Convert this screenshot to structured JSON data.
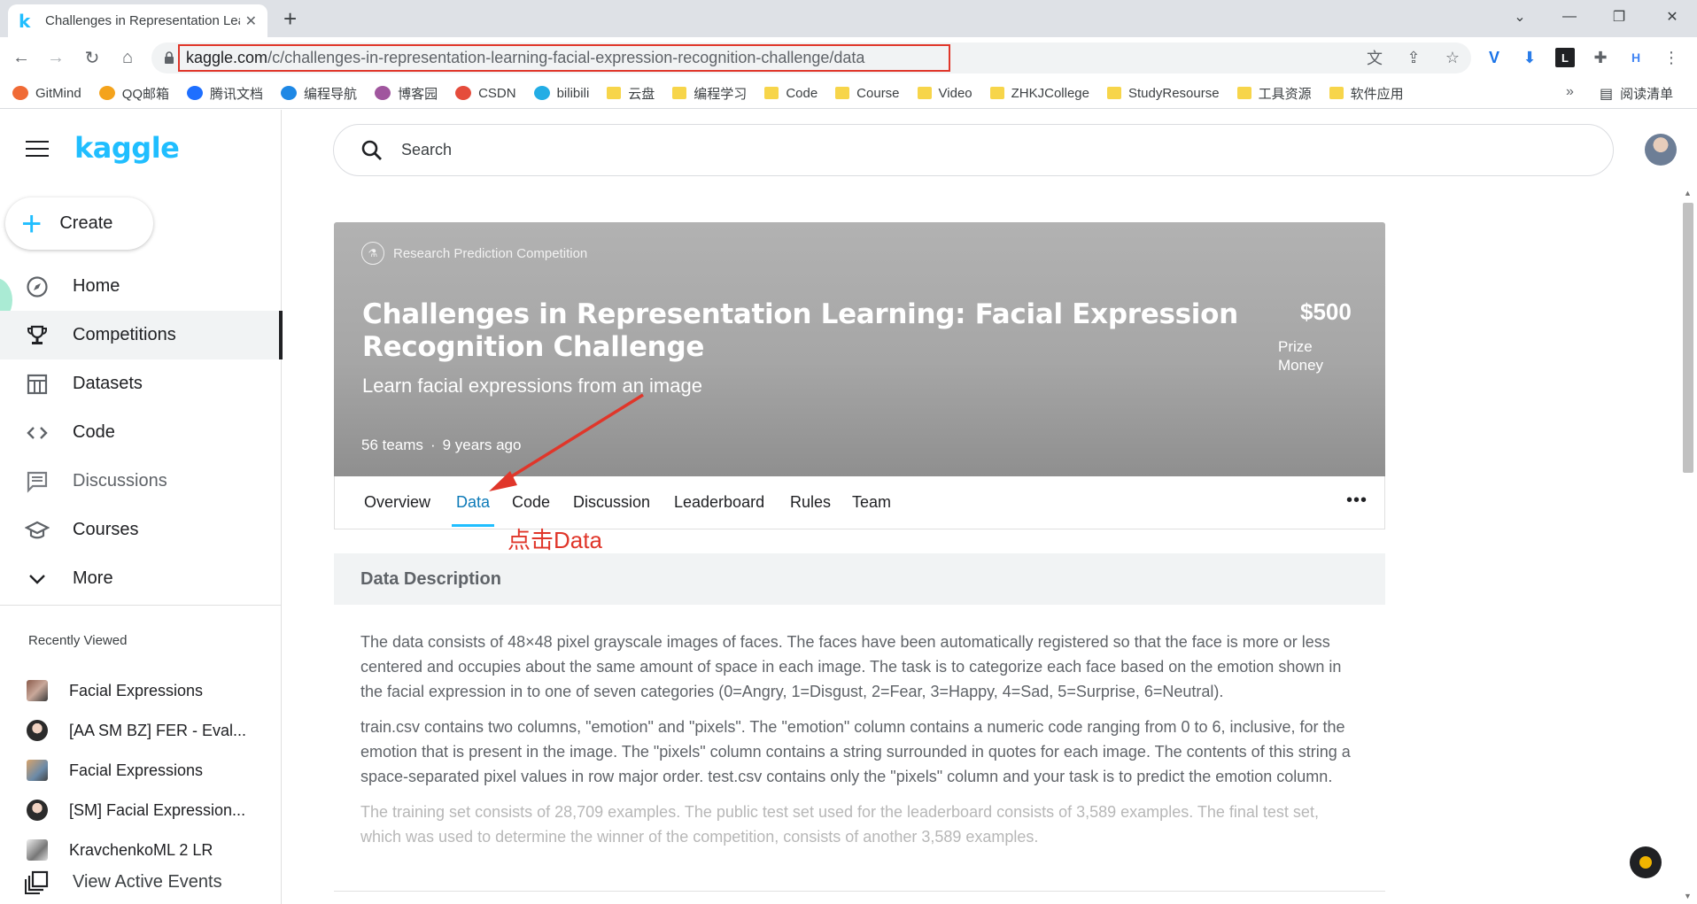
{
  "browser": {
    "tab_title": "Challenges in Representation Learning: Facial Expression Recognition Challenge",
    "tab_favicon": "k",
    "url_host": "kaggle.com",
    "url_path": "/c/challenges-in-representation-learning-facial-expression-recognition-challenge/data",
    "bookmarks": [
      {
        "label": "GitMind",
        "icon": "gitmind-icon",
        "color": "#f06a35"
      },
      {
        "label": "QQ邮箱",
        "icon": "qqmail-icon",
        "color": "#f4a31c"
      },
      {
        "label": "腾讯文档",
        "icon": "tencent-docs-icon",
        "color": "#1e6fff"
      },
      {
        "label": "编程导航",
        "icon": "code-nav-icon",
        "color": "#1e88e5"
      },
      {
        "label": "博客园",
        "icon": "cnblogs-icon",
        "color": "#a0569e"
      },
      {
        "label": "CSDN",
        "icon": "csdn-icon",
        "color": "#e54c3c"
      },
      {
        "label": "bilibili",
        "icon": "bilibili-icon",
        "color": "#23ade5"
      },
      {
        "label": "云盘",
        "icon": "folder-icon",
        "color": "#f7d54a"
      },
      {
        "label": "编程学习",
        "icon": "folder-icon",
        "color": "#f7d54a"
      },
      {
        "label": "Code",
        "icon": "folder-icon",
        "color": "#f7d54a"
      },
      {
        "label": "Course",
        "icon": "folder-icon",
        "color": "#f7d54a"
      },
      {
        "label": "Video",
        "icon": "folder-icon",
        "color": "#f7d54a"
      },
      {
        "label": "ZHKJCollege",
        "icon": "folder-icon",
        "color": "#f7d54a"
      },
      {
        "label": "StudyResourse",
        "icon": "folder-icon",
        "color": "#f7d54a"
      },
      {
        "label": "工具资源",
        "icon": "folder-icon",
        "color": "#f7d54a"
      },
      {
        "label": "软件应用",
        "icon": "folder-icon",
        "color": "#f7d54a"
      }
    ],
    "bookmarks_more": "»",
    "reading_list": "阅读清单"
  },
  "sidebar": {
    "logo": "kaggle",
    "create_label": "Create",
    "nav": [
      {
        "label": "Home",
        "name": "home"
      },
      {
        "label": "Competitions",
        "name": "competitions"
      },
      {
        "label": "Datasets",
        "name": "datasets"
      },
      {
        "label": "Code",
        "name": "code"
      },
      {
        "label": "Discussions",
        "name": "discussions"
      },
      {
        "label": "Courses",
        "name": "courses"
      },
      {
        "label": "More",
        "name": "more"
      }
    ],
    "recently_viewed_title": "Recently Viewed",
    "recently_viewed": [
      {
        "label": "Facial Expressions"
      },
      {
        "label": "[AA SM BZ] FER - Eval..."
      },
      {
        "label": "Facial Expressions"
      },
      {
        "label": "[SM] Facial Expression..."
      },
      {
        "label": "KravchenkoML 2 LR"
      }
    ],
    "view_active_events": "View Active Events"
  },
  "search": {
    "placeholder": "Search"
  },
  "competition": {
    "type": "Research Prediction Competition",
    "title": "Challenges in Representation Learning: Facial Expression Recognition Challenge",
    "subtitle": "Learn facial expressions from an image",
    "prize": "$500",
    "prize_label": "Prize Money",
    "teams": "56 teams",
    "age": "9 years ago",
    "meta_separator": "·"
  },
  "tabs": [
    {
      "label": "Overview"
    },
    {
      "label": "Data"
    },
    {
      "label": "Code"
    },
    {
      "label": "Discussion"
    },
    {
      "label": "Leaderboard"
    },
    {
      "label": "Rules"
    },
    {
      "label": "Team"
    }
  ],
  "tabs_more": "•••",
  "annotation": "点击Data",
  "data_description": {
    "heading": "Data Description",
    "paragraphs": [
      "The data consists of 48×48 pixel grayscale images of faces. The faces have been automatically registered so that the face is more or less centered and occupies about the same amount of space in each image. The task is to categorize each face based on the emotion shown in the facial expression in to one of seven categories (0=Angry, 1=Disgust, 2=Fear, 3=Happy, 4=Sad, 5=Surprise, 6=Neutral).",
      "train.csv contains two columns, \"emotion\" and \"pixels\". The \"emotion\" column contains a numeric code ranging from 0 to 6, inclusive, for the emotion that is present in the image. The \"pixels\" column contains a string surrounded in quotes for each image. The contents of this string a space-separated pixel values in row major order. test.csv contains only the \"pixels\" column and your task is to predict the emotion column.",
      "The training set consists of 28,709 examples. The public test set used for the leaderboard consists of 3,589 examples. The final test set, which was used to determine the winner of the competition, consists of another 3,589 examples."
    ]
  },
  "colors": {
    "kaggle_blue": "#20beff",
    "annotation_red": "#e0362a"
  }
}
